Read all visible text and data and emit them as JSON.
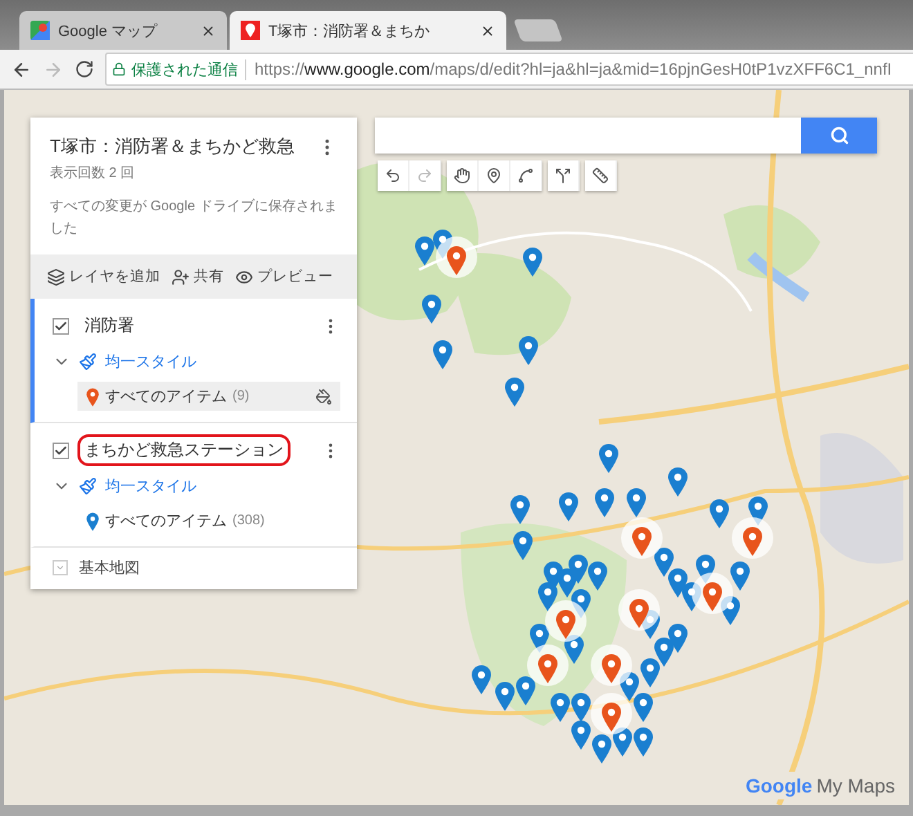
{
  "browser": {
    "tabs": [
      {
        "label": "Google マップ",
        "selected": false
      },
      {
        "label": "T塚市：消防署＆まちか",
        "selected": true
      }
    ],
    "security": "保護された通信",
    "url_scheme": "https://",
    "url_host": "www.google.com",
    "url_path": "/maps/d/edit?hl=ja&hl=ja&mid=16pjnGesH0tP1vzXFF6C1_nnfI"
  },
  "panel": {
    "title": "T塚市：消防署＆まちかど救急",
    "views": "表示回数 2 回",
    "save_status": "すべての変更が Google ドライブに保存されました",
    "actions": [
      {
        "kind": "layers",
        "label": "レイヤを追加"
      },
      {
        "kind": "share",
        "label": "共有"
      },
      {
        "kind": "preview",
        "label": "プレビュー"
      }
    ],
    "layers": [
      {
        "name": "消防署",
        "checked": true,
        "selected": true,
        "highlighted": false,
        "style": "均一スタイル",
        "items_label": "すべてのアイテム",
        "count": "(9)",
        "color": "#e8541c"
      },
      {
        "name": "まちかど救急ステーション",
        "checked": true,
        "selected": false,
        "highlighted": true,
        "style": "均一スタイル",
        "items_label": "すべてのアイテム",
        "count": "(308)",
        "color": "#1a7fd0"
      }
    ],
    "base_map": "基本地図"
  },
  "map": {
    "logo_google": "Google",
    "logo_suffix": "My Maps"
  }
}
